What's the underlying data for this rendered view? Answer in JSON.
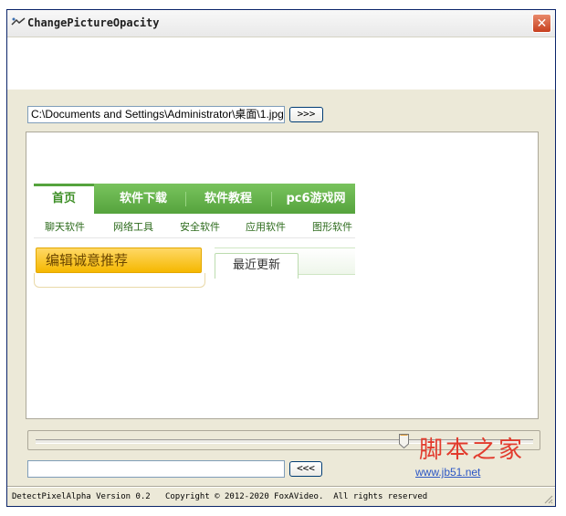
{
  "window": {
    "title": "ChangePictureOpacity",
    "close_glyph": "✕"
  },
  "path_input": {
    "value": "C:\\Documents and Settings\\Administrator\\桌面\\1.jpg"
  },
  "buttons": {
    "forward_label": ">>>",
    "back_label": "<<<"
  },
  "preview": {
    "nav_tabs": [
      "首页",
      "软件下载",
      "软件教程",
      "pc6游戏网"
    ],
    "active_tab": "首页",
    "subnav": [
      "聊天软件",
      "网络工具",
      "安全软件",
      "应用软件",
      "图形软件"
    ],
    "recommend_label": "编辑诚意推荐",
    "recent_label": "最近更新"
  },
  "slider": {
    "value": 0.74
  },
  "bottom_input": {
    "value": ""
  },
  "status": {
    "text": "DetectPixelAlpha Version 0.2   Copyright © 2012-2020 FoxAVideo.  All rights reserved"
  },
  "watermark": {
    "title": "脚本之家",
    "url": "www.jb51.net"
  },
  "colors": {
    "window_bg": "#ece9d8",
    "nav_green": "#55a33d",
    "close_red": "#c7401f",
    "watermark_red": "#e23b2d"
  }
}
